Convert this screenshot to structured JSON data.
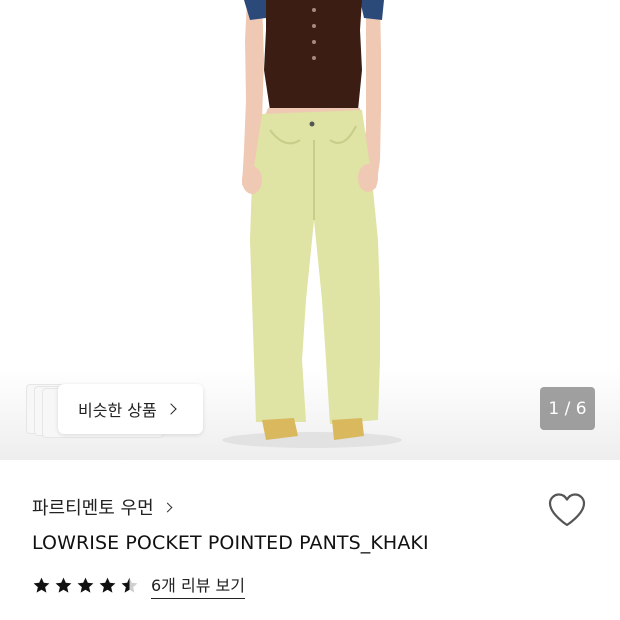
{
  "gallery": {
    "similar_label": "비슷한 상품",
    "counter": "1 / 6"
  },
  "product": {
    "brand": "파르티멘토 우먼",
    "title": "LOWRISE POCKET POINTED PANTS_KHAKI",
    "rating": 4.5,
    "review_link": "6개 리뷰 보기"
  },
  "icons": {
    "wishlist": "heart-outline-icon",
    "similar_chevron": "chevron-right-icon",
    "brand_chevron": "chevron-right-icon",
    "star": "star-icon"
  },
  "colors": {
    "pants": "#dfe3a3",
    "top": "#3b1d14",
    "shoes": "#d9b85e"
  }
}
